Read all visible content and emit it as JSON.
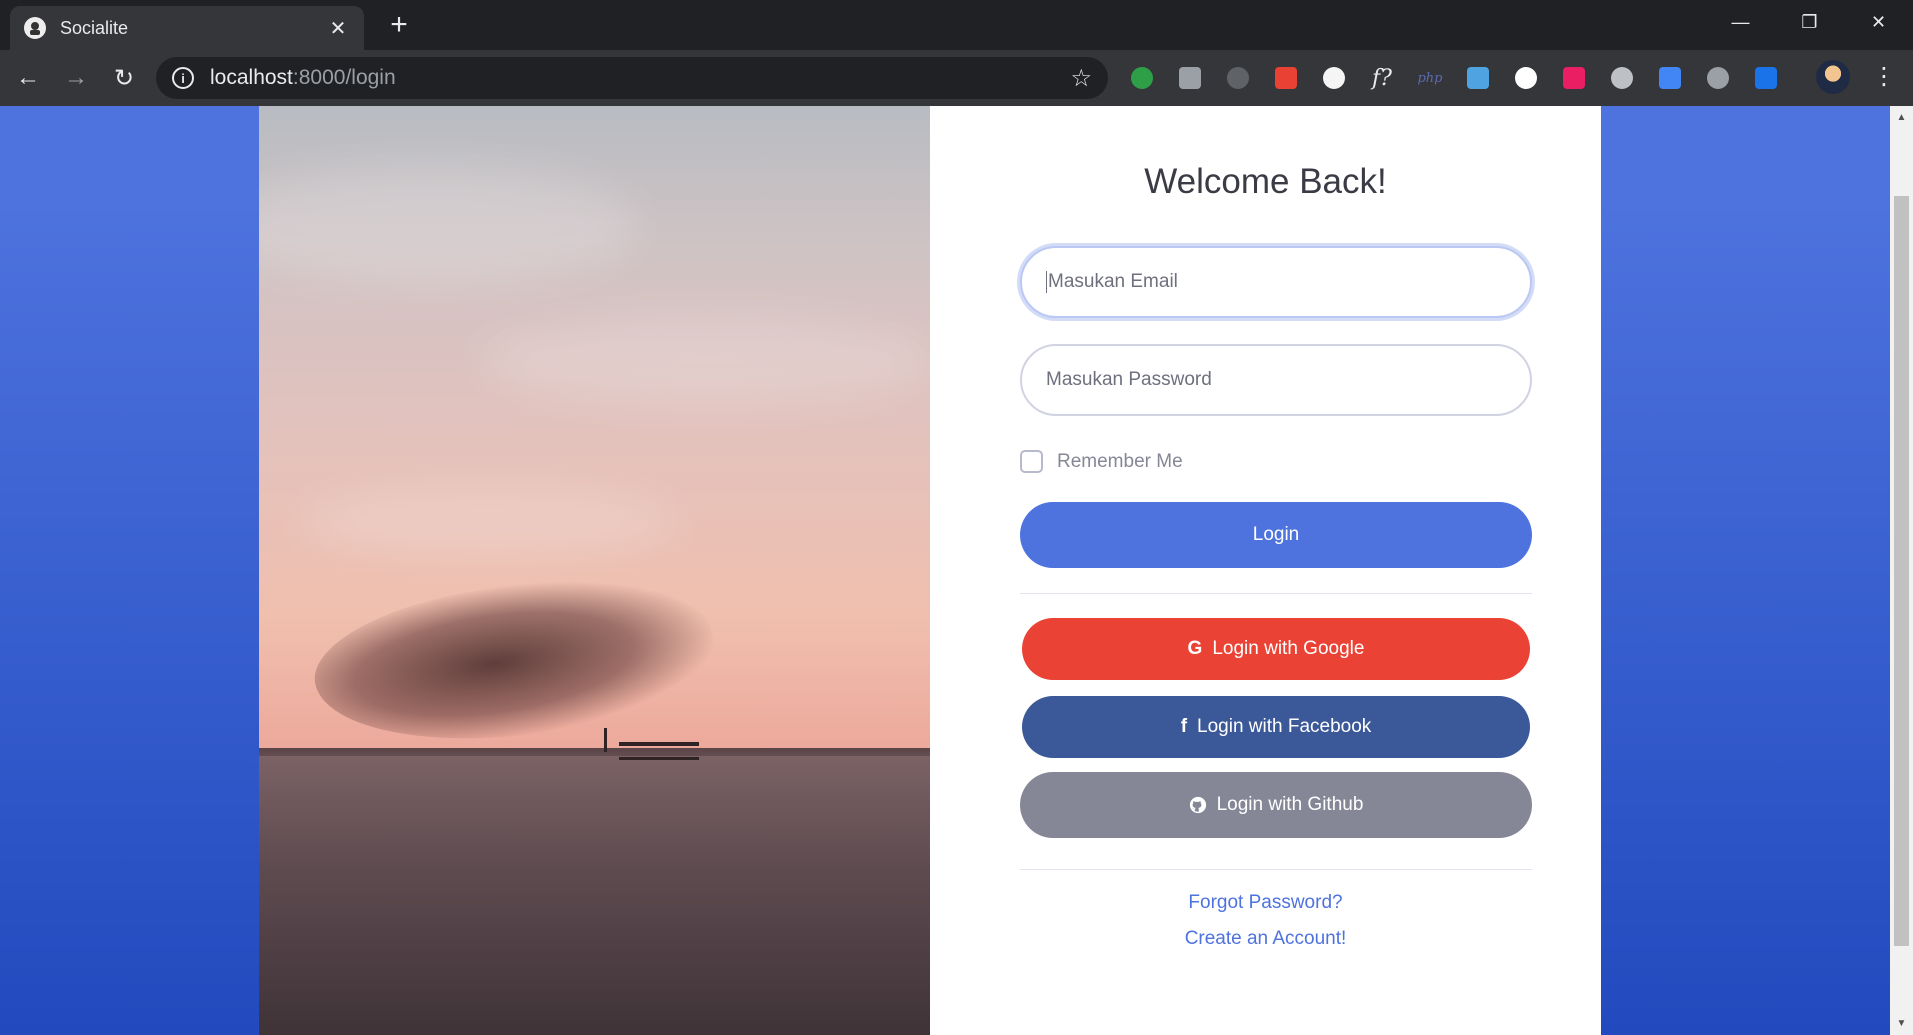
{
  "browser": {
    "tab_title": "Socialite",
    "tab_close": "✕",
    "new_tab": "+",
    "url_host": "localhost",
    "url_rest": ":8000/login",
    "window_controls": {
      "minimize": "—",
      "restore": "❐",
      "close": "✕"
    },
    "nav": {
      "back": "←",
      "forward": "→",
      "reload": "↻"
    },
    "star": "☆",
    "menu": "⋮",
    "extensions": [
      {
        "name": "color-wheel-extension-icon",
        "color": "#2e9f47"
      },
      {
        "name": "gear-extension-icon",
        "color": "#9aa0a6"
      },
      {
        "name": "crosshair-extension-icon",
        "color": "#5f6368"
      },
      {
        "name": "palette-extension-icon",
        "color": "#e94235"
      },
      {
        "name": "notepad-extension-icon",
        "color": "#f5f5f5"
      },
      {
        "name": "font-extension-icon",
        "color": "#e8eaed",
        "label": "f?"
      },
      {
        "name": "php-extension-icon",
        "color": "#5a6ab0",
        "label": "php"
      },
      {
        "name": "globe-extension-icon",
        "color": "#4fa3e0"
      },
      {
        "name": "drop-extension-icon",
        "color": "#ffffff"
      },
      {
        "name": "ring-extension-icon",
        "color": "#e91e63"
      },
      {
        "name": "camera-extension-icon",
        "color": "#bdc1c6"
      },
      {
        "name": "translate-extension-icon",
        "color": "#4285f4"
      },
      {
        "name": "copy-extension-icon",
        "color": "#9aa0a6"
      },
      {
        "name": "diamond-extension-icon",
        "color": "#1a73e8"
      }
    ]
  },
  "page": {
    "title": "Welcome Back!",
    "email_placeholder": "Masukan Email",
    "password_placeholder": "Masukan Password",
    "remember_label": "Remember Me",
    "login_label": "Login",
    "google_label": "Login with Google",
    "google_icon": "G",
    "facebook_label": "Login with Facebook",
    "facebook_icon": "f",
    "github_label": "Login with Github",
    "forgot_label": "Forgot Password?",
    "create_label": "Create an Account!"
  },
  "colors": {
    "primary": "#4e73df",
    "google": "#ea4335",
    "facebook": "#3b5998",
    "github": "#858796",
    "background_gradient_top": "#4e73df",
    "background_gradient_bottom": "#224abe"
  }
}
